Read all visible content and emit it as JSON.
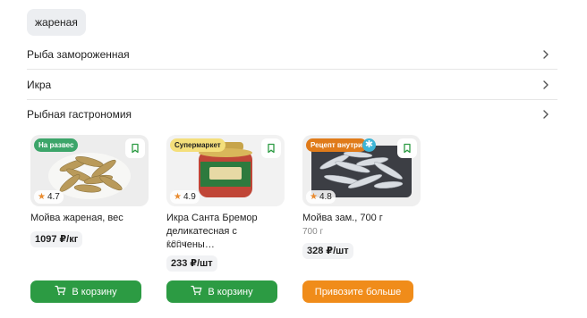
{
  "chip": {
    "label": "жареная"
  },
  "categories": [
    {
      "label": "Рыба замороженная"
    },
    {
      "label": "Икра"
    },
    {
      "label": "Рыбная гастрономия"
    }
  ],
  "products": [
    {
      "badge": "На развес",
      "badge_color": "#3ca56a",
      "rating": "4.7",
      "name": "Мойва жареная, вес",
      "weight": "",
      "price": "1097 ₽/кг",
      "button": "В корзину",
      "button_style": "green"
    },
    {
      "badge": "Супермаркет",
      "badge_color": "#f4df7b",
      "rating": "4.9",
      "name": "Икра Санта Бремор деликатесная с копчены…",
      "weight": "180 г",
      "price": "233 ₽/шт",
      "button": "В корзину",
      "button_style": "green"
    },
    {
      "badge": "Рецепт внутри",
      "badge_color": "#e07b1a",
      "rating": "4.8",
      "name": "Мойва зам., 700 г",
      "weight": "700 г",
      "price": "328 ₽/шт",
      "button": "Привозите больше",
      "button_style": "orange"
    }
  ],
  "icons": {
    "chevron": "chevron-right-icon",
    "favorite": "bookmark-icon",
    "cart": "cart-icon",
    "frozen": "snowflake-icon",
    "star": "star-icon"
  }
}
